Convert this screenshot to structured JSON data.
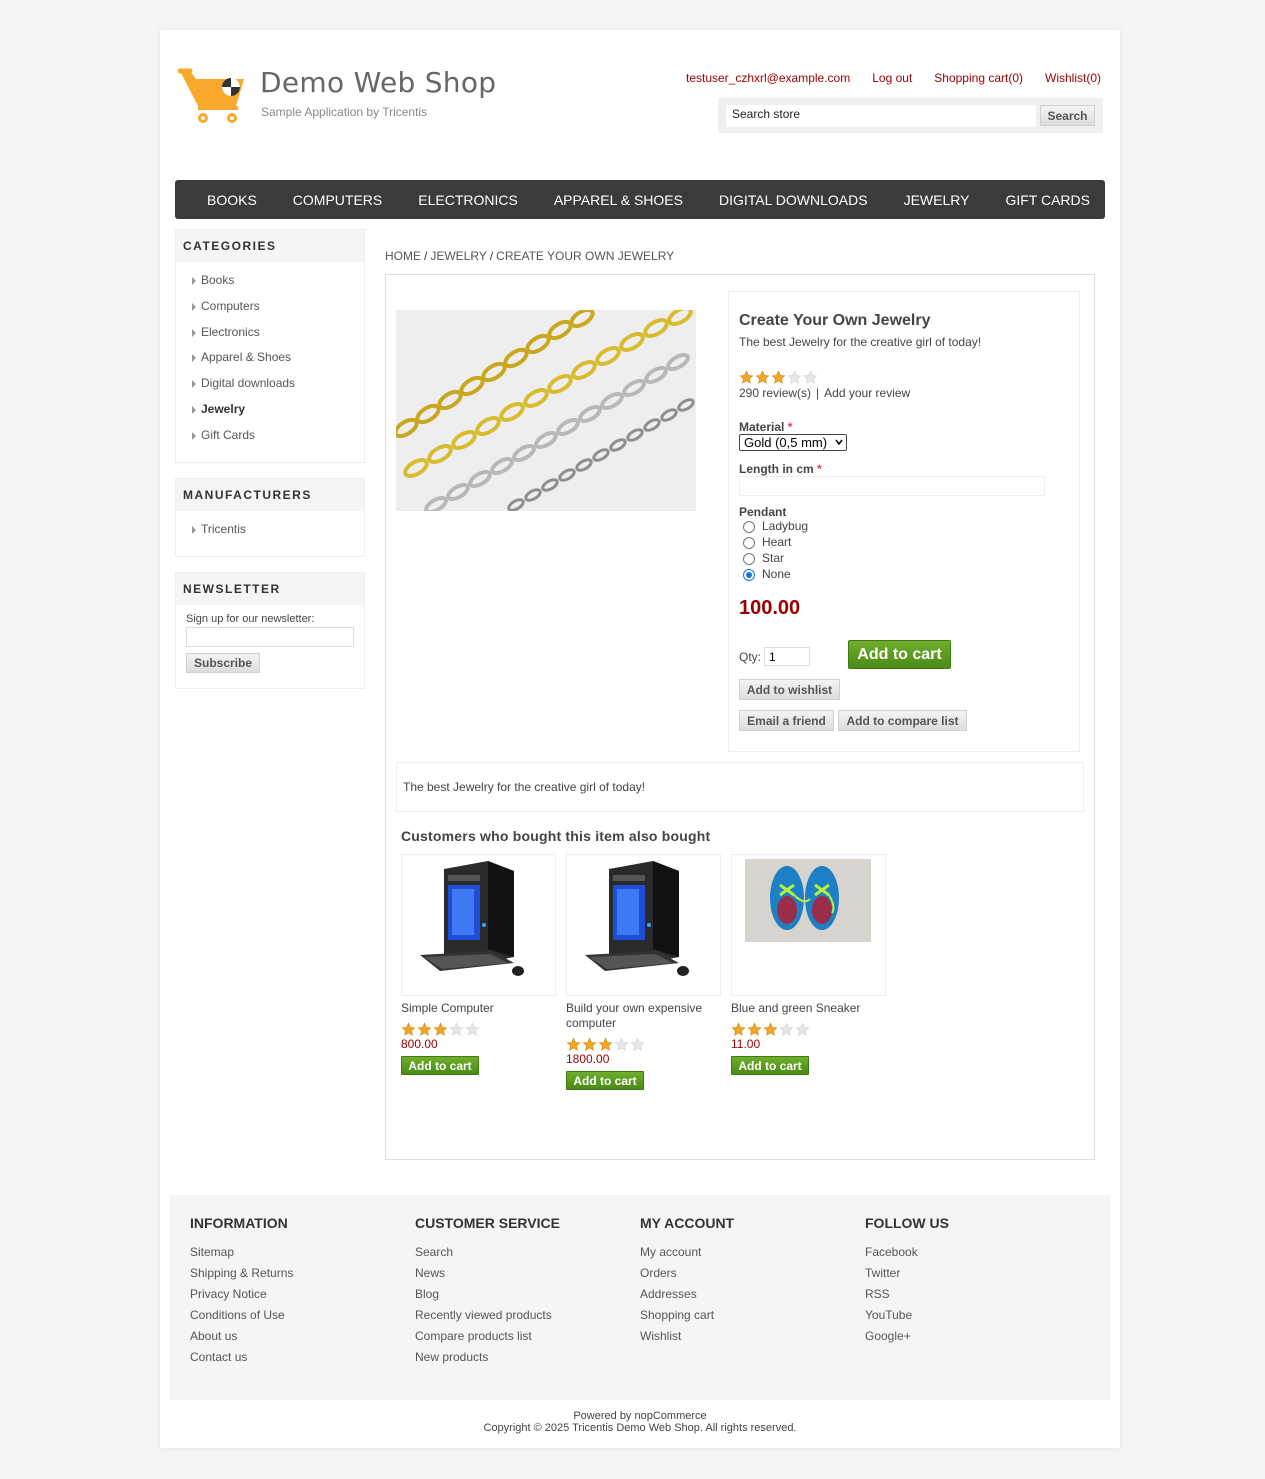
{
  "header": {
    "logo_title": "Demo Web Shop",
    "logo_subtitle": "Sample Application by Tricentis",
    "user_email": "testuser_czhxrl@example.com",
    "logout": "Log out",
    "shopping_cart": "Shopping cart(0)",
    "wishlist": "Wishlist(0)",
    "search_placeholder": "Search store",
    "search_button": "Search"
  },
  "top_menu": [
    "BOOKS",
    "COMPUTERS",
    "ELECTRONICS",
    "APPAREL & SHOES",
    "DIGITAL DOWNLOADS",
    "JEWELRY",
    "GIFT CARDS"
  ],
  "sidebar": {
    "categories_title": "Categories",
    "categories": [
      "Books",
      "Computers",
      "Electronics",
      "Apparel & Shoes",
      "Digital downloads",
      "Jewelry",
      "Gift Cards"
    ],
    "active_category": "Jewelry",
    "manufacturers_title": "Manufacturers",
    "manufacturers": [
      "Tricentis"
    ],
    "newsletter_title": "Newsletter",
    "newsletter_label": "Sign up for our newsletter:",
    "subscribe_button": "Subscribe"
  },
  "breadcrumb": {
    "home": "HOME",
    "category": "JEWELRY",
    "current": "CREATE YOUR OWN JEWELRY"
  },
  "product": {
    "name": "Create Your Own Jewelry",
    "short_description": "The best Jewelry for the creative girl of today!",
    "rating": 3,
    "rating_max": 5,
    "reviews": "290 review(s)",
    "add_review": "Add your review",
    "material_label": "Material",
    "material_value": "Gold (0,5 mm)",
    "length_label": "Length in cm",
    "length_value": "",
    "pendant_label": "Pendant",
    "pendant_options": [
      "Ladybug",
      "Heart",
      "Star",
      "None"
    ],
    "pendant_selected": "None",
    "price": "100.00",
    "qty_label": "Qty:",
    "qty_value": "1",
    "add_to_cart": "Add to cart",
    "add_to_wishlist": "Add to wishlist",
    "email_friend": "Email a friend",
    "add_to_compare": "Add to compare list",
    "full_description": "The best Jewelry for the creative girl of today!"
  },
  "also_bought": {
    "title": "Customers who bought this item also bought",
    "items": [
      {
        "name": "Simple Computer",
        "price": "800.00",
        "rating": 3,
        "button": "Add to cart"
      },
      {
        "name": "Build your own expensive computer",
        "price": "1800.00",
        "rating": 3,
        "button": "Add to cart"
      },
      {
        "name": "Blue and green Sneaker",
        "price": "11.00",
        "rating": 3,
        "button": "Add to cart"
      }
    ]
  },
  "footer": {
    "information": {
      "title": "Information",
      "links": [
        "Sitemap",
        "Shipping & Returns",
        "Privacy Notice",
        "Conditions of Use",
        "About us",
        "Contact us"
      ]
    },
    "customer_service": {
      "title": "Customer service",
      "links": [
        "Search",
        "News",
        "Blog",
        "Recently viewed products",
        "Compare products list",
        "New products"
      ]
    },
    "my_account": {
      "title": "My account",
      "links": [
        "My account",
        "Orders",
        "Addresses",
        "Shopping cart",
        "Wishlist"
      ]
    },
    "follow_us": {
      "title": "Follow us",
      "links": [
        "Facebook",
        "Twitter",
        "RSS",
        "YouTube",
        "Google+"
      ]
    },
    "powered_by": "Powered by nopCommerce",
    "copyright": "Copyright © 2025 Tricentis Demo Web Shop. All rights reserved."
  },
  "colors": {
    "accent_red": "#990000",
    "menu_bg": "#3b3b3b",
    "green_button": "#5c9d20",
    "star": "#f5a623"
  }
}
